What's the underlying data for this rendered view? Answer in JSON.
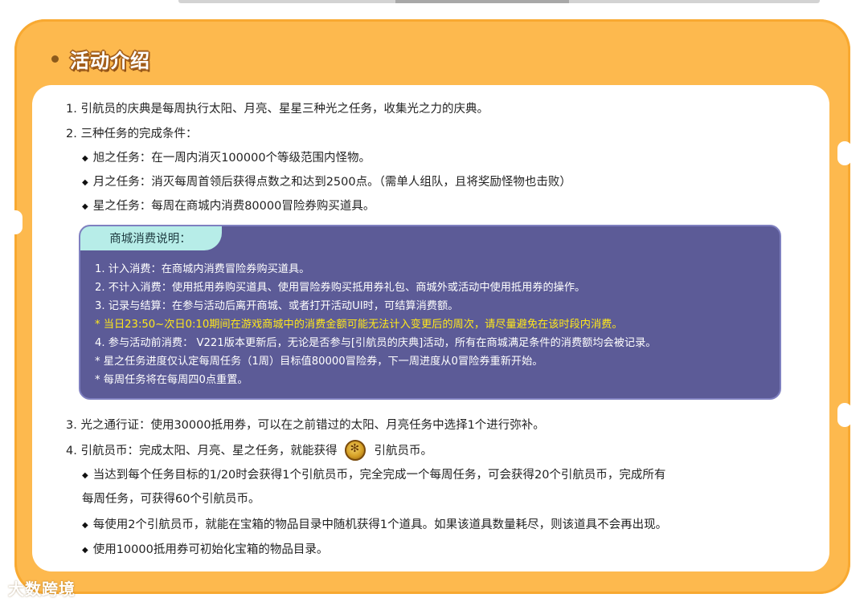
{
  "section": {
    "title": "活动介绍"
  },
  "intro": [
    "1. 引航员的庆典是每周执行太阳、月亮、星星三种光之任务，收集光之力的庆典。",
    "2. 三种任务的完成条件："
  ],
  "tasks": [
    "旭之任务：在一周内消灭100000个等级范围内怪物。",
    "月之任务：消灭每周首领后获得点数之和达到2500点。（需单人组队，且将奖励怪物也击败）",
    "星之任务：每周在商城内消费80000冒险券购买道具。"
  ],
  "shop_box": {
    "title": "商城消费说明：",
    "lines": [
      "1. 计入消费：在商城内消费冒险券购买道具。",
      "2. 不计入消费：使用抵用券购买道具、使用冒险券购买抵用券礼包、商城外或活动中使用抵用券的操作。",
      "3. 记录与结算：在参与活动后离开商城、或者打开活动UI时，可结算消费额。",
      "* 当日23:50~次日0:10期间在游戏商城中的消费金额可能无法计入变更后的周次，请尽量避免在该时段内消费。",
      "4. 参与活动前消费： V221版本更新后，无论是否参与[引航员的庆典]活动，所有在商城满足条件的消费额均会被记录。",
      "* 星之任务进度仅认定每周任务（1周）目标值80000冒险券，下一周进度从0冒险券重新开始。",
      "* 每周任务将在每周四0点重置。"
    ],
    "warn_color": "#ffe81a"
  },
  "item3": "3. 光之通行证：使用30000抵用券，可以在之前错过的太阳、月亮任务中选择1个进行弥补。",
  "item4": {
    "prefix": "4. 引航员币：完成太阳、月亮、星之任务，就能获得",
    "suffix": "引航员币。",
    "coin_icon": "navigator-coin-icon"
  },
  "coin_rules": [
    "当达到每个任务目标的1/20时会获得1个引航员币，完全完成一个每周任务，可会获得20个引航员币，完成所有",
    "每周任务，可获得60个引航员币。",
    "每使用2个引航员币，就能在宝箱的物品目录中随机获得1个道具。如果该道具数量耗尽，则该道具不会再出现。",
    "使用10000抵用券可初始化宝箱的物品目录。"
  ],
  "diamond": "◆",
  "watermark": "大数跨境",
  "colors": {
    "frame": "#fdb94e",
    "shop_box_bg": "#5c5b97",
    "shop_tab_bg": "#b7ede8",
    "warn_text": "#ffe81a"
  }
}
